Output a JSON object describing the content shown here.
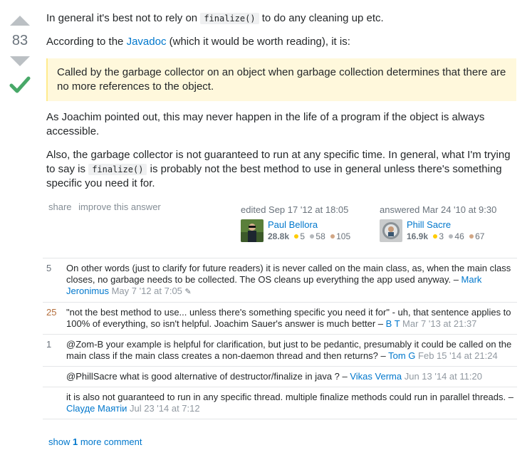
{
  "vote": {
    "count": "83"
  },
  "post": {
    "p1_before": "In general it's best not to rely on ",
    "p1_code": "finalize()",
    "p1_after": " to do any cleaning up etc.",
    "p2_before": "According to the ",
    "p2_link": "Javadoc",
    "p2_after": " (which it would be worth reading), it is:",
    "quote": "Called by the garbage collector on an object when garbage collection determines that there are no more references to the object.",
    "p3": "As Joachim pointed out, this may never happen in the life of a program if the object is always accessible.",
    "p4_before": "Also, the garbage collector is not guaranteed to run at any specific time. In general, what I'm trying to say is ",
    "p4_code": "finalize()",
    "p4_after": " is probably not the best method to use in general unless there's something specific you need it for."
  },
  "menu": {
    "share": "share",
    "improve": "improve this answer"
  },
  "edited": {
    "action": "edited Sep 17 '12 at 18:05",
    "user": "Paul Bellora",
    "rep": "28.8k",
    "gold": "5",
    "silver": "58",
    "bronze": "105"
  },
  "answered": {
    "action": "answered Mar 24 '10 at 9:30",
    "user": "Phill Sacre",
    "rep": "16.9k",
    "gold": "3",
    "silver": "46",
    "bronze": "67"
  },
  "comments": [
    {
      "score": "5",
      "text": "On other words (just to clarify for future readers) it is never called on the main class, as, when the main class closes, no garbage needs to be collected. The OS cleans up everything the app used anyway. – ",
      "user": "Mark Jeronimus",
      "date": "May 7 '12 at 7:05"
    },
    {
      "score": "25",
      "text": "\"not the best method to use... unless there's something specific you need it for\" - uh, that sentence applies to 100% of everything, so isn't helpful. Joachim Sauer's answer is much better – ",
      "user": "B T",
      "date": "Mar 7 '13 at 21:37"
    },
    {
      "score": "1",
      "text": "@Zom-B your example is helpful for clarification, but just to be pedantic, presumably it could be called on the main class if the main class creates a non-daemon thread and then returns? – ",
      "user": "Tom G",
      "date": "Feb 15 '14 at 21:24"
    },
    {
      "score": "",
      "text": "@PhillSacre what is good alternative of destructor/finalize in java ? – ",
      "user": "Vikas Verma",
      "date": "Jun 13 '14 at 11:20"
    },
    {
      "score": "",
      "text": "it is also not guaranteed to run in any specific thread. multiple finalize methods could run in parallel threads. – ",
      "user": "Claудe Маятiи",
      "date": "Jul 23 '14 at 7:12"
    }
  ],
  "show_more": {
    "before": "show ",
    "count": "1",
    "after": " more comment"
  }
}
